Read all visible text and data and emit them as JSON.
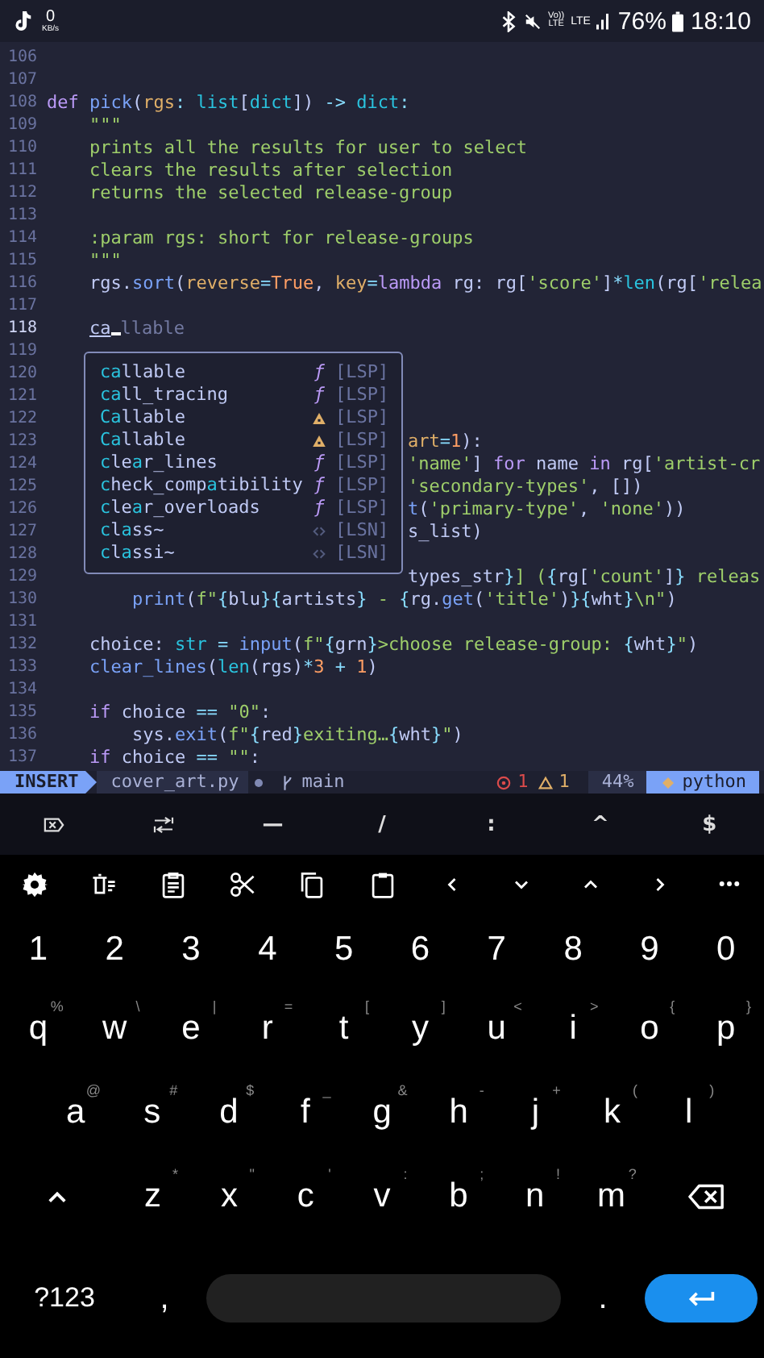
{
  "phone_status": {
    "speed_value": "0",
    "speed_unit": "KB/s",
    "volte_top": "Vo))",
    "volte_bottom": "LTE",
    "network": "LTE",
    "battery": "76%",
    "time": "18:10"
  },
  "editor": {
    "lines": [
      {
        "number": "106",
        "current": false,
        "kind": "code"
      },
      {
        "number": "107",
        "current": false,
        "kind": "code"
      },
      {
        "number": "108",
        "current": false,
        "kind": "code",
        "segments": [
          {
            "kind": "keyword",
            "s": "def "
          },
          {
            "kind": "function",
            "s": "pick"
          },
          {
            "kind": "plain",
            "s": "("
          },
          {
            "kind": "param",
            "s": "rgs"
          },
          {
            "kind": "operator",
            "s": ": "
          },
          {
            "kind": "type",
            "s": "list"
          },
          {
            "kind": "plain",
            "s": "["
          },
          {
            "kind": "type",
            "s": "dict"
          },
          {
            "kind": "plain",
            "s": "]) "
          },
          {
            "kind": "operator",
            "s": "-> "
          },
          {
            "kind": "type",
            "s": "dict"
          },
          {
            "kind": "operator",
            "s": ":"
          }
        ]
      },
      {
        "number": "109",
        "current": false,
        "kind": "code",
        "segments": [
          {
            "kind": "string",
            "s": "    \"\"\""
          }
        ]
      },
      {
        "number": "110",
        "current": false,
        "kind": "code",
        "segments": [
          {
            "kind": "string",
            "s": "    prints all the results for user to select"
          }
        ]
      },
      {
        "number": "111",
        "current": false,
        "kind": "code",
        "segments": [
          {
            "kind": "string",
            "s": "    clears the results after selection"
          }
        ]
      },
      {
        "number": "112",
        "current": false,
        "kind": "code",
        "segments": [
          {
            "kind": "string",
            "s": "    returns the selected release-group"
          }
        ]
      },
      {
        "number": "113",
        "current": false,
        "kind": "code"
      },
      {
        "number": "114",
        "current": false,
        "kind": "code",
        "segments": [
          {
            "kind": "string",
            "s": "    :param rgs: short for release-groups"
          }
        ]
      },
      {
        "number": "115",
        "current": false,
        "kind": "code",
        "segments": [
          {
            "kind": "string",
            "s": "    \"\"\""
          }
        ]
      },
      {
        "number": "116",
        "current": false,
        "kind": "code",
        "segments": [
          {
            "kind": "plain",
            "s": "    rgs."
          },
          {
            "kind": "function",
            "s": "sort"
          },
          {
            "kind": "plain",
            "s": "("
          },
          {
            "kind": "param",
            "s": "reverse"
          },
          {
            "kind": "operator",
            "s": "="
          },
          {
            "kind": "constant",
            "s": "True"
          },
          {
            "kind": "plain",
            "s": ", "
          },
          {
            "kind": "param",
            "s": "key"
          },
          {
            "kind": "operator",
            "s": "="
          },
          {
            "kind": "keyword",
            "s": "lambda"
          },
          {
            "kind": "plain",
            "s": " rg: rg["
          },
          {
            "kind": "string",
            "s": "'score'"
          },
          {
            "kind": "plain",
            "s": "]"
          },
          {
            "kind": "operator",
            "s": "*"
          },
          {
            "kind": "builtin",
            "s": "len"
          },
          {
            "kind": "plain",
            "s": "(rg["
          },
          {
            "kind": "string",
            "s": "'relea"
          }
        ]
      },
      {
        "number": "117",
        "current": false,
        "kind": "code"
      },
      {
        "number": "118",
        "current": true,
        "kind": "input",
        "typed": "ca",
        "ghost": "llable"
      },
      {
        "number": "119",
        "current": false,
        "kind": "code"
      },
      {
        "number": "120",
        "current": false,
        "kind": "code"
      },
      {
        "number": "121",
        "current": false,
        "kind": "code"
      },
      {
        "number": "122",
        "current": false,
        "kind": "code"
      },
      {
        "number": "123",
        "current": false,
        "kind": "behind_popup",
        "segments": [
          {
            "kind": "param",
            "s": "art"
          },
          {
            "kind": "operator",
            "s": "="
          },
          {
            "kind": "number",
            "s": "1"
          },
          {
            "kind": "plain",
            "s": "):"
          }
        ]
      },
      {
        "number": "124",
        "current": false,
        "kind": "behind_popup",
        "segments": [
          {
            "kind": "string",
            "s": "'name'"
          },
          {
            "kind": "plain",
            "s": "] "
          },
          {
            "kind": "keyword",
            "s": "for"
          },
          {
            "kind": "plain",
            "s": " name "
          },
          {
            "kind": "keyword",
            "s": "in"
          },
          {
            "kind": "plain",
            "s": " rg["
          },
          {
            "kind": "string",
            "s": "'artist-cr"
          }
        ]
      },
      {
        "number": "125",
        "current": false,
        "kind": "behind_popup",
        "segments": [
          {
            "kind": "string",
            "s": "'secondary-types'"
          },
          {
            "kind": "plain",
            "s": ", [])"
          }
        ]
      },
      {
        "number": "126",
        "current": false,
        "kind": "behind_popup",
        "segments": [
          {
            "kind": "function",
            "s": "t"
          },
          {
            "kind": "plain",
            "s": "("
          },
          {
            "kind": "string",
            "s": "'primary-type'"
          },
          {
            "kind": "plain",
            "s": ", "
          },
          {
            "kind": "string",
            "s": "'none'"
          },
          {
            "kind": "plain",
            "s": "))"
          }
        ]
      },
      {
        "number": "127",
        "current": false,
        "kind": "behind_popup",
        "segments": [
          {
            "kind": "plain",
            "s": "s_list)"
          }
        ]
      },
      {
        "number": "128",
        "current": false,
        "kind": "code"
      },
      {
        "number": "129",
        "current": false,
        "kind": "behind_popup",
        "segments": [
          {
            "kind": "plain",
            "s": "types_str"
          },
          {
            "kind": "operator",
            "s": "}"
          },
          {
            "kind": "string",
            "s": "] ("
          },
          {
            "kind": "operator",
            "s": "{"
          },
          {
            "kind": "plain",
            "s": "rg["
          },
          {
            "kind": "string",
            "s": "'count'"
          },
          {
            "kind": "plain",
            "s": "]"
          },
          {
            "kind": "operator",
            "s": "}"
          },
          {
            "kind": "string",
            "s": " releas"
          }
        ]
      },
      {
        "number": "130",
        "current": false,
        "kind": "code",
        "segments": [
          {
            "kind": "function",
            "s": "        print"
          },
          {
            "kind": "plain",
            "s": "("
          },
          {
            "kind": "string",
            "s": "f\""
          },
          {
            "kind": "operator",
            "s": "{"
          },
          {
            "kind": "plain",
            "s": "blu"
          },
          {
            "kind": "operator",
            "s": "}{"
          },
          {
            "kind": "plain",
            "s": "artists"
          },
          {
            "kind": "operator",
            "s": "}"
          },
          {
            "kind": "string",
            "s": " - "
          },
          {
            "kind": "operator",
            "s": "{"
          },
          {
            "kind": "plain",
            "s": "rg."
          },
          {
            "kind": "function",
            "s": "get"
          },
          {
            "kind": "plain",
            "s": "("
          },
          {
            "kind": "string",
            "s": "'title'"
          },
          {
            "kind": "plain",
            "s": ")"
          },
          {
            "kind": "operator",
            "s": "}{"
          },
          {
            "kind": "plain",
            "s": "wht"
          },
          {
            "kind": "operator",
            "s": "}"
          },
          {
            "kind": "string",
            "s": "\\n\""
          },
          {
            "kind": "plain",
            "s": ")"
          }
        ]
      },
      {
        "number": "131",
        "current": false,
        "kind": "code"
      },
      {
        "number": "132",
        "current": false,
        "kind": "code",
        "segments": [
          {
            "kind": "plain",
            "s": "    choice: "
          },
          {
            "kind": "type",
            "s": "str "
          },
          {
            "kind": "operator",
            "s": "= "
          },
          {
            "kind": "function",
            "s": "input"
          },
          {
            "kind": "plain",
            "s": "("
          },
          {
            "kind": "string",
            "s": "f\""
          },
          {
            "kind": "operator",
            "s": "{"
          },
          {
            "kind": "plain",
            "s": "grn"
          },
          {
            "kind": "operator",
            "s": "}"
          },
          {
            "kind": "string",
            "s": ">choose release-group: "
          },
          {
            "kind": "operator",
            "s": "{"
          },
          {
            "kind": "plain",
            "s": "wht"
          },
          {
            "kind": "operator",
            "s": "}"
          },
          {
            "kind": "string",
            "s": "\""
          },
          {
            "kind": "plain",
            "s": ")"
          }
        ]
      },
      {
        "number": "133",
        "current": false,
        "kind": "code",
        "segments": [
          {
            "kind": "function",
            "s": "    clear_lines"
          },
          {
            "kind": "plain",
            "s": "("
          },
          {
            "kind": "builtin",
            "s": "len"
          },
          {
            "kind": "plain",
            "s": "(rgs)"
          },
          {
            "kind": "operator",
            "s": "*"
          },
          {
            "kind": "number",
            "s": "3 "
          },
          {
            "kind": "operator",
            "s": "+ "
          },
          {
            "kind": "number",
            "s": "1"
          },
          {
            "kind": "plain",
            "s": ")"
          }
        ]
      },
      {
        "number": "134",
        "current": false,
        "kind": "code"
      },
      {
        "number": "135",
        "current": false,
        "kind": "code",
        "segments": [
          {
            "kind": "keyword",
            "s": "    if"
          },
          {
            "kind": "plain",
            "s": " choice "
          },
          {
            "kind": "operator",
            "s": "== "
          },
          {
            "kind": "string",
            "s": "\"0\""
          },
          {
            "kind": "plain",
            "s": ":"
          }
        ]
      },
      {
        "number": "136",
        "current": false,
        "kind": "code",
        "segments": [
          {
            "kind": "plain",
            "s": "        sys."
          },
          {
            "kind": "function",
            "s": "exit"
          },
          {
            "kind": "plain",
            "s": "("
          },
          {
            "kind": "string",
            "s": "f\""
          },
          {
            "kind": "operator",
            "s": "{"
          },
          {
            "kind": "plain",
            "s": "red"
          },
          {
            "kind": "operator",
            "s": "}"
          },
          {
            "kind": "string",
            "s": "exiting…"
          },
          {
            "kind": "operator",
            "s": "{"
          },
          {
            "kind": "plain",
            "s": "wht"
          },
          {
            "kind": "operator",
            "s": "}"
          },
          {
            "kind": "string",
            "s": "\""
          },
          {
            "kind": "plain",
            "s": ")"
          }
        ]
      },
      {
        "number": "137",
        "current": false,
        "kind": "code",
        "segments": [
          {
            "kind": "keyword",
            "s": "    if"
          },
          {
            "kind": "plain",
            "s": " choice "
          },
          {
            "kind": "operator",
            "s": "== "
          },
          {
            "kind": "string",
            "s": "\"\""
          },
          {
            "kind": "plain",
            "s": ":"
          }
        ]
      }
    ]
  },
  "completion": {
    "items": [
      {
        "kind": "function",
        "icon": "ƒ",
        "source": "[LSP]",
        "parts": [
          {
            "s": "ca",
            "match": true
          },
          {
            "s": "llable",
            "match": false
          }
        ]
      },
      {
        "kind": "function",
        "icon": "ƒ",
        "source": "[LSP]",
        "parts": [
          {
            "s": "ca",
            "match": true
          },
          {
            "s": "ll_tracing",
            "match": false
          }
        ]
      },
      {
        "kind": "class",
        "source": "[LSP]",
        "parts": [
          {
            "s": "Ca",
            "match": true
          },
          {
            "s": "llable",
            "match": false
          }
        ]
      },
      {
        "kind": "class",
        "source": "[LSP]",
        "parts": [
          {
            "s": "Ca",
            "match": true
          },
          {
            "s": "llable",
            "match": false
          }
        ]
      },
      {
        "kind": "function",
        "icon": "ƒ",
        "source": "[LSP]",
        "parts": [
          {
            "s": "c",
            "match": true
          },
          {
            "s": "le",
            "match": false
          },
          {
            "s": "a",
            "match": true
          },
          {
            "s": "r_lines",
            "match": false
          }
        ]
      },
      {
        "kind": "function",
        "icon": "ƒ",
        "source": "[LSP]",
        "parts": [
          {
            "s": "c",
            "match": true
          },
          {
            "s": "heck_comp",
            "match": false
          },
          {
            "s": "a",
            "match": true
          },
          {
            "s": "tibility",
            "match": false
          }
        ]
      },
      {
        "kind": "function",
        "icon": "ƒ",
        "source": "[LSP]",
        "parts": [
          {
            "s": "c",
            "match": true
          },
          {
            "s": "le",
            "match": false
          },
          {
            "s": "a",
            "match": true
          },
          {
            "s": "r_overloads",
            "match": false
          }
        ]
      },
      {
        "kind": "snippet",
        "source": "[LSN]",
        "parts": [
          {
            "s": "c",
            "match": true
          },
          {
            "s": "l",
            "match": false
          },
          {
            "s": "a",
            "match": true
          },
          {
            "s": "ss~",
            "match": false
          }
        ]
      },
      {
        "kind": "snippet",
        "source": "[LSN]",
        "parts": [
          {
            "s": "c",
            "match": true
          },
          {
            "s": "l",
            "match": false
          },
          {
            "s": "a",
            "match": true
          },
          {
            "s": "ssi~",
            "match": false
          }
        ]
      }
    ]
  },
  "statusline": {
    "mode": "INSERT",
    "file": "cover_art.py",
    "modified": true,
    "branch": "main",
    "errors": "1",
    "warnings": "1",
    "progress": "44%",
    "filetype": "python"
  },
  "extra_keys": [
    {
      "kind": "clear"
    },
    {
      "kind": "tab"
    },
    {
      "kind": "text",
      "label": "—"
    },
    {
      "kind": "text",
      "label": "/"
    },
    {
      "kind": "text",
      "label": ":"
    },
    {
      "kind": "text",
      "label": "^"
    },
    {
      "kind": "text",
      "label": "$"
    }
  ],
  "keyboard": {
    "toolbar": [
      {
        "kind": "settings"
      },
      {
        "kind": "clear-list"
      },
      {
        "kind": "note"
      },
      {
        "kind": "cut"
      },
      {
        "kind": "copy"
      },
      {
        "kind": "paste"
      },
      {
        "kind": "left"
      },
      {
        "kind": "down"
      },
      {
        "kind": "up"
      },
      {
        "kind": "right"
      },
      {
        "kind": "more"
      }
    ],
    "number_row": [
      "1",
      "2",
      "3",
      "4",
      "5",
      "6",
      "7",
      "8",
      "9",
      "0"
    ],
    "row_1": [
      {
        "label": "q",
        "hint": "%"
      },
      {
        "label": "w",
        "hint": "\\"
      },
      {
        "label": "e",
        "hint": "|"
      },
      {
        "label": "r",
        "hint": "="
      },
      {
        "label": "t",
        "hint": "["
      },
      {
        "label": "y",
        "hint": "]"
      },
      {
        "label": "u",
        "hint": "<"
      },
      {
        "label": "i",
        "hint": ">"
      },
      {
        "label": "o",
        "hint": "{"
      },
      {
        "label": "p",
        "hint": "}"
      }
    ],
    "row_2": [
      {
        "label": "a",
        "hint": "@"
      },
      {
        "label": "s",
        "hint": "#"
      },
      {
        "label": "d",
        "hint": "$"
      },
      {
        "label": "f",
        "hint": "_"
      },
      {
        "label": "g",
        "hint": "&"
      },
      {
        "label": "h",
        "hint": "-"
      },
      {
        "label": "j",
        "hint": "+"
      },
      {
        "label": "k",
        "hint": "("
      },
      {
        "label": "l",
        "hint": ")"
      }
    ],
    "row_3": [
      {
        "label": "z",
        "hint": "*"
      },
      {
        "label": "x",
        "hint": "\""
      },
      {
        "label": "c",
        "hint": "'"
      },
      {
        "label": "v",
        "hint": ":"
      },
      {
        "label": "b",
        "hint": ";"
      },
      {
        "label": "n",
        "hint": "!"
      },
      {
        "label": "m",
        "hint": "?"
      }
    ],
    "symbols": "?123",
    "comma": ",",
    "period": "."
  }
}
